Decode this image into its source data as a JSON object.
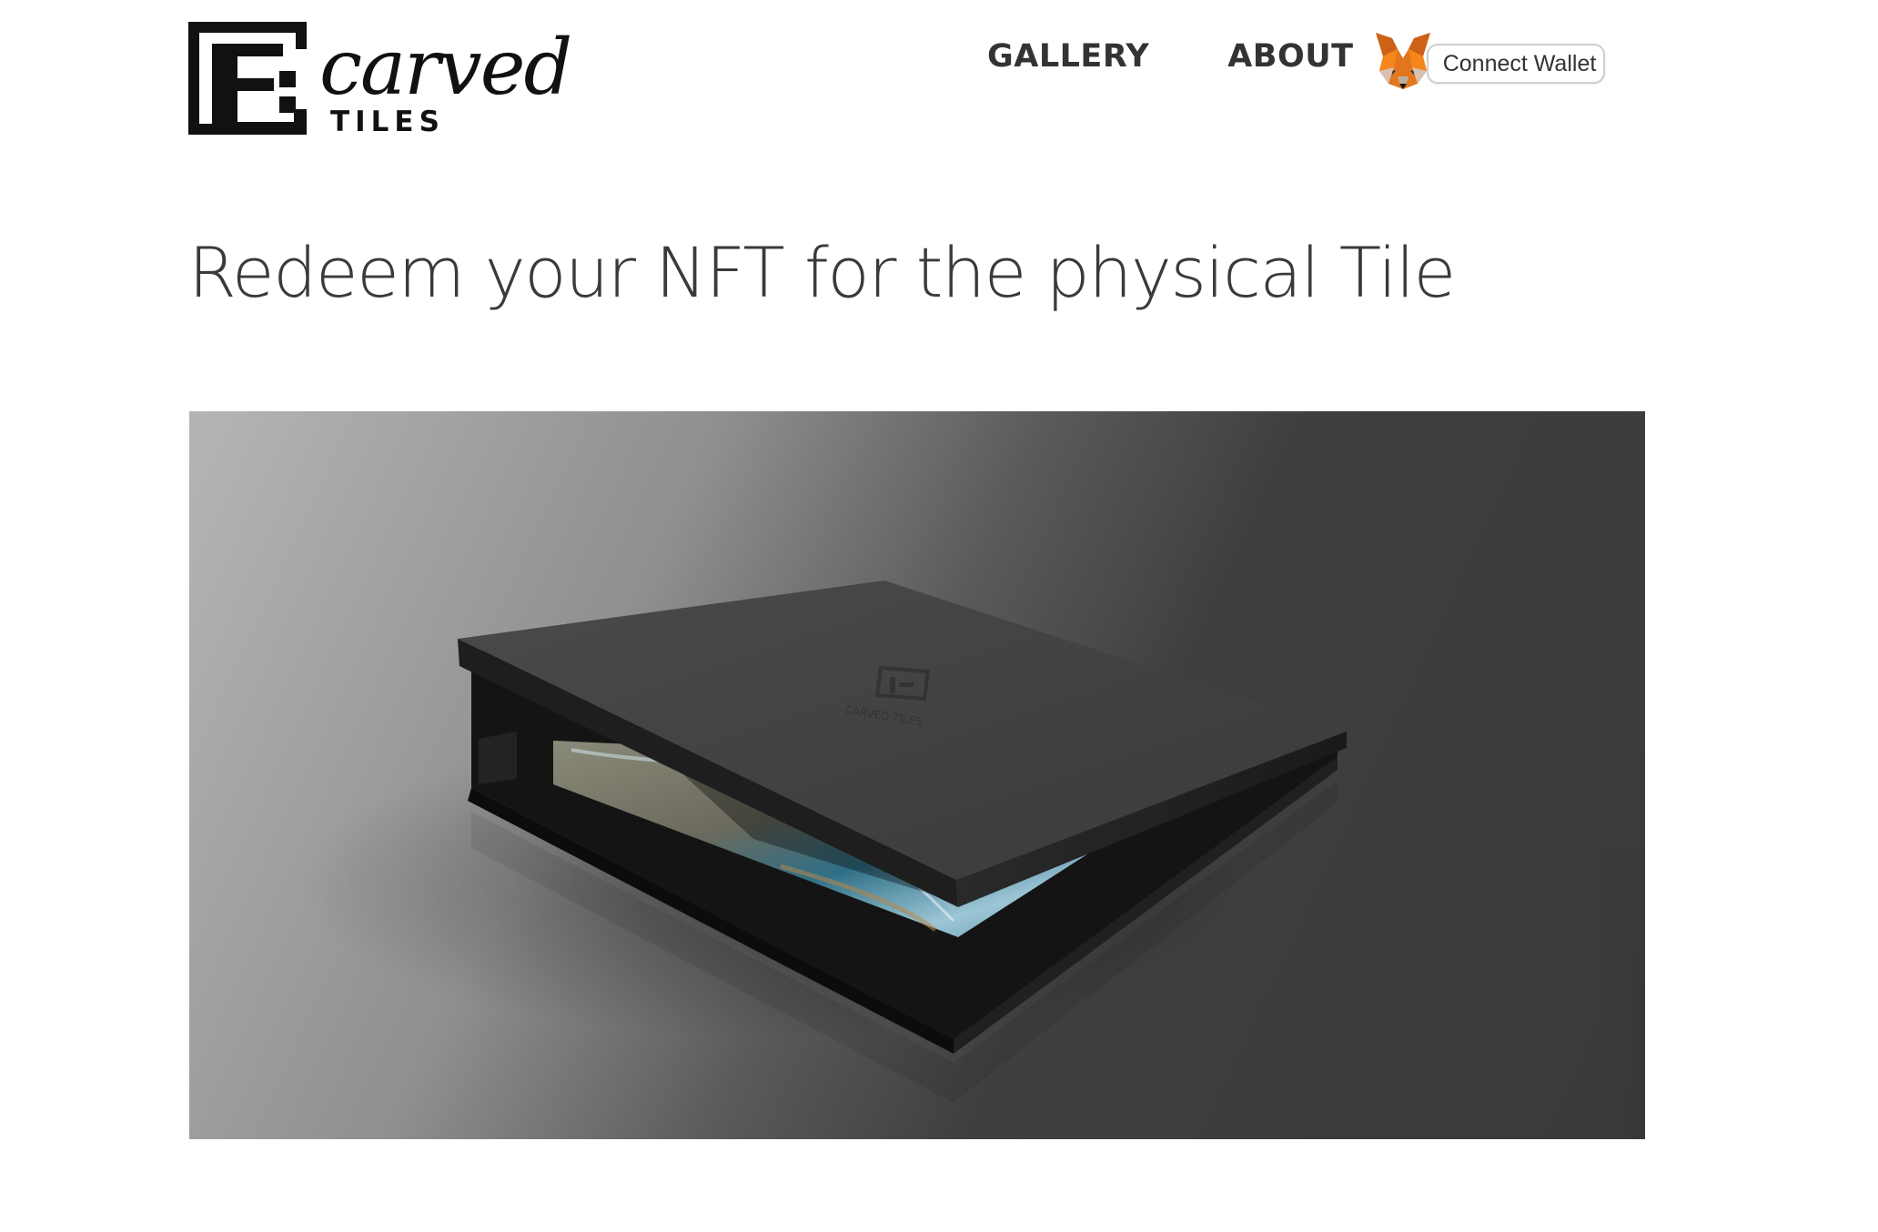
{
  "header": {
    "logo": {
      "script": "carved",
      "subtitle": "TILES"
    },
    "nav": {
      "gallery": "GALLERY",
      "about": "ABOUT"
    },
    "wallet": {
      "icon": "metamask-fox-icon",
      "label": "Connect Wallet"
    }
  },
  "main": {
    "title": "Redeem your NFT for the physical Tile",
    "hero_image": {
      "subject": "box-with-tile-image",
      "box_lid_logo": "CARVED TILES"
    }
  },
  "colors": {
    "text_dark": "#111111",
    "nav_text": "#333333",
    "headline": "#3a3a3a",
    "fox_orange": "#e2761b",
    "background": "#ffffff"
  }
}
